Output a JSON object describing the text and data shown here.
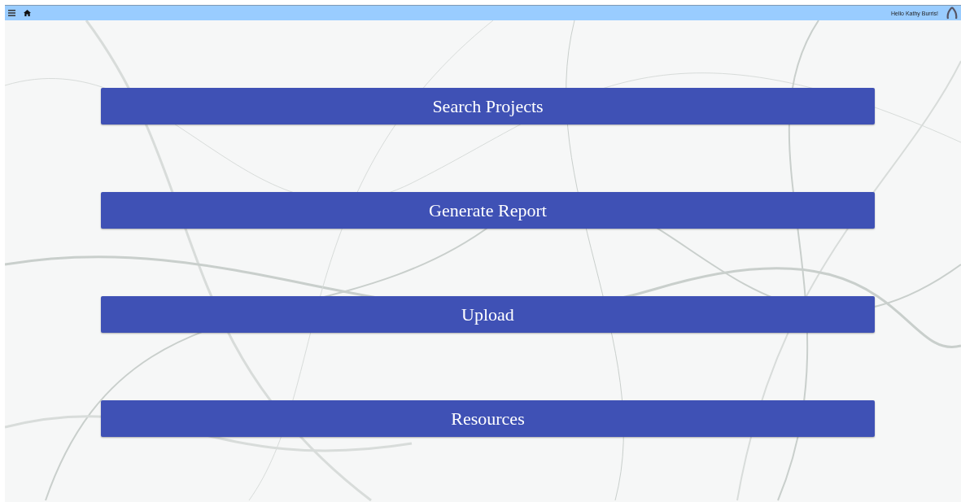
{
  "top_bar": {
    "greeting": "Hello Kathy Burris!"
  },
  "buttons": [
    {
      "label": "Search Projects"
    },
    {
      "label": "Generate Report"
    },
    {
      "label": "Upload"
    },
    {
      "label": "Resources"
    }
  ]
}
